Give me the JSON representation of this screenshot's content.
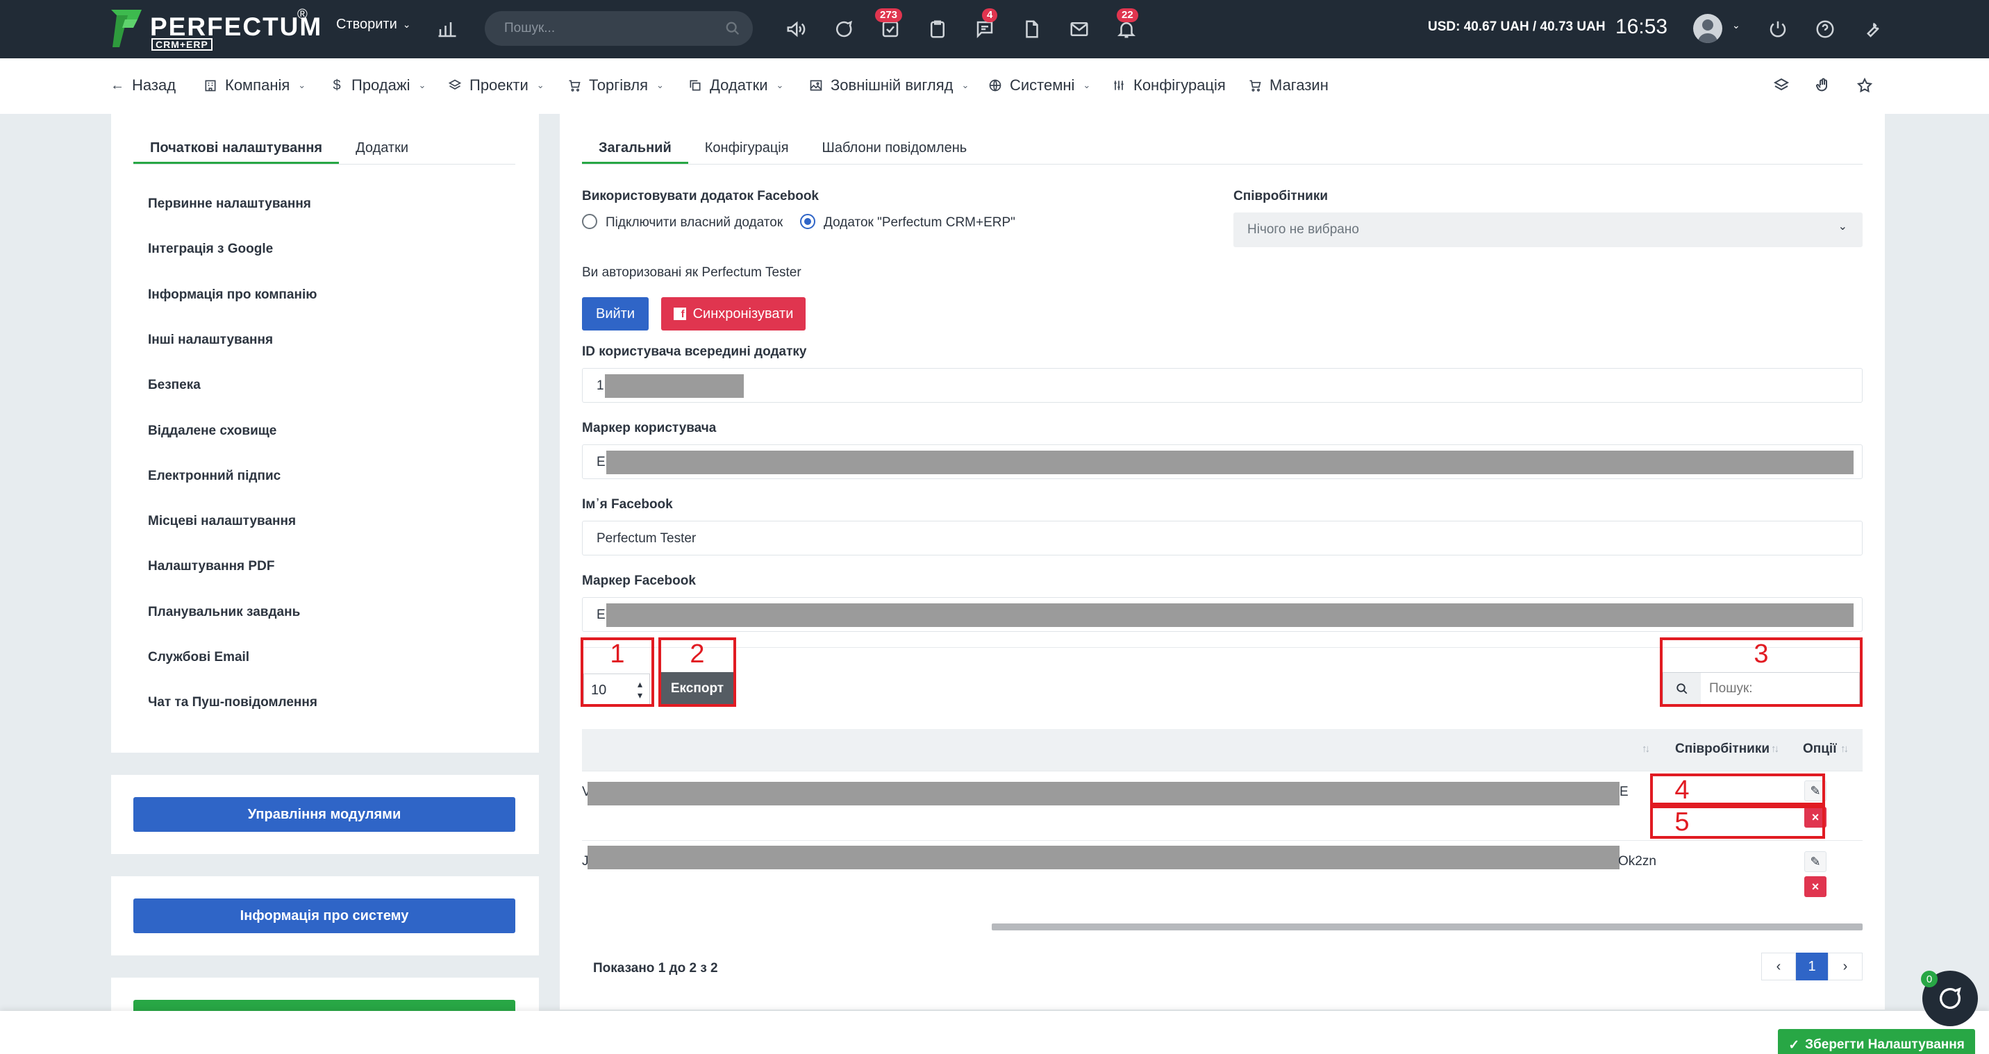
{
  "header": {
    "brand": "PERFECTUM",
    "brand_reg": "®",
    "brand_sub": "CRM+ERP",
    "create_label": "Створити",
    "search_placeholder": "Пошук...",
    "badges": {
      "tasks": "273",
      "messages": "4",
      "notifications": "22"
    },
    "currency": "USD: 40.67 UAH / 40.73 UAH",
    "time": "16:53"
  },
  "nav": {
    "back": "Назад",
    "company": "Компанія",
    "sales": "Продажі",
    "projects": "Проекти",
    "trade": "Торгівля",
    "addons": "Додатки",
    "appearance": "Зовнішній вигляд",
    "system": "Системні",
    "config": "Конфігурація",
    "shop": "Магазин"
  },
  "left": {
    "tabs": [
      "Початкові налаштування",
      "Додатки"
    ],
    "menu": [
      "Первинне налаштування",
      "Інтеграція з Google",
      "Інформація про компанію",
      "Інші налаштування",
      "Безпека",
      "Віддалене сховище",
      "Електронний підпис",
      "Місцеві налаштування",
      "Налаштування PDF",
      "Планувальник завдань",
      "Службові Email",
      "Чат та Пуш-повідомлення"
    ],
    "modules_button": "Управління модулями",
    "sysinfo_button": "Інформація про систему"
  },
  "main": {
    "tabs": [
      "Загальний",
      "Конфігурація",
      "Шаблони повідомлень"
    ],
    "use_app_label": "Використовувати додаток Facebook",
    "radio_own": "Підключити власний додаток",
    "radio_perfectum": "Додаток \"Perfectum CRM+ERP\"",
    "employees_label": "Співробітники",
    "employees_placeholder": "Нічого не вибрано",
    "authorized_text": "Ви авторизовані як Perfectum Tester",
    "logout_button": "Вийти",
    "sync_button": "Синхронізувати",
    "app_user_id_label": "ID користувача всередині додатку",
    "app_user_id_value": "1",
    "user_token_label": "Маркер користувача",
    "user_token_value": "E",
    "fb_name_label": "Ім᾿я Facebook",
    "fb_name_value": "Perfectum Tester",
    "fb_token_label": "Маркер Facebook",
    "fb_token_value": "E"
  },
  "table": {
    "page_length": "10",
    "export_label": "Експорт",
    "search_placeholder": "Пошук:",
    "columns": [
      "Співробітники",
      "Опції"
    ],
    "rows": [
      {
        "prefix": "V",
        "suffix": "E"
      },
      {
        "prefix": "J",
        "suffix": "Ok2zn"
      }
    ],
    "info": "Показано 1 до 2 з 2",
    "pages": {
      "prev": "‹",
      "current": "1",
      "next": "›"
    }
  },
  "annotations": [
    "1",
    "2",
    "3",
    "4",
    "5"
  ],
  "footer": {
    "save_button": "Зберегти Налаштування",
    "chat_badge": "0"
  },
  "colors": {
    "topbar": "#212b36",
    "primary": "#2f65c7",
    "success": "#28a745",
    "danger": "#e0354f",
    "annotation": "#e11b22"
  }
}
